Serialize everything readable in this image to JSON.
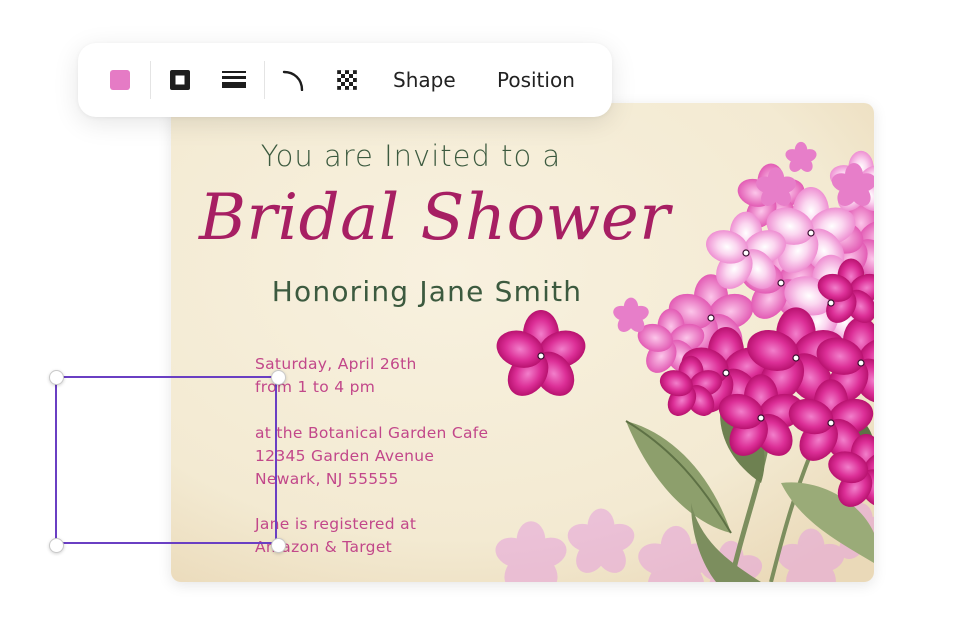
{
  "toolbar": {
    "fill_color": "#e57bc5",
    "tools": [
      "color-swatch",
      "border-square-icon",
      "line-weight-icon",
      "corner-radius-icon",
      "transparency-icon"
    ],
    "shape_label": "Shape",
    "position_label": "Position"
  },
  "card": {
    "title_line": "You are Invited to a",
    "headline": "Bridal Shower",
    "honoring": "Honoring Jane Smith",
    "date": "Saturday, April 26th",
    "time": "from 1 to 4 pm",
    "venue": "at the Botanical Garden Cafe",
    "street": "12345 Garden Avenue",
    "city": "Newark, NJ 55555",
    "registry_line1": "Jane is registered at",
    "registry_line2": "Amazon & Target",
    "colors": {
      "headline": "#a71f63",
      "green_text": "#3c5a3f",
      "detail_text": "#c2478a",
      "paper": "#f6eedb",
      "flower_dark": "#d8228e",
      "flower_light": "#f08fd0"
    }
  },
  "selection": {
    "color": "#6a3fc3"
  }
}
